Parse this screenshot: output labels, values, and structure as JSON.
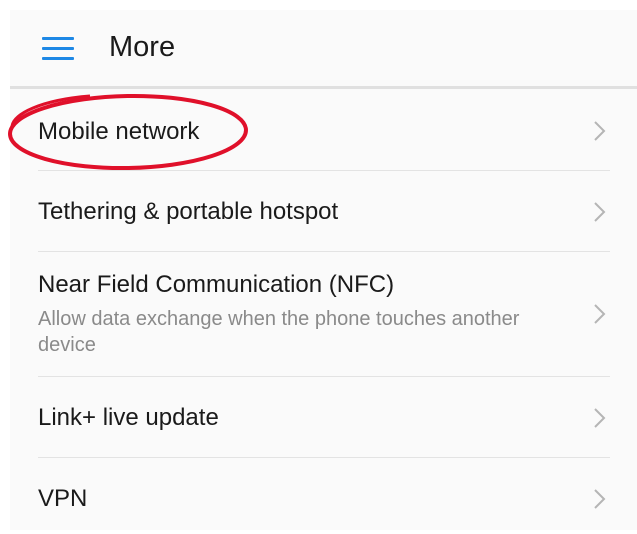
{
  "header": {
    "title": "More",
    "menu_icon": "hamburger-menu-icon",
    "accent_color": "#1e88e5"
  },
  "settings": {
    "items": [
      {
        "title": "Mobile network",
        "subtitle": "",
        "icon": "chevron-right-icon"
      },
      {
        "title": "Tethering & portable hotspot",
        "subtitle": "",
        "icon": "chevron-right-icon"
      },
      {
        "title": "Near Field Communication (NFC)",
        "subtitle": "Allow data exchange when the phone touches another device",
        "icon": "chevron-right-icon"
      },
      {
        "title": "Link+ live update",
        "subtitle": "",
        "icon": "chevron-right-icon"
      },
      {
        "title": "VPN",
        "subtitle": "",
        "icon": "chevron-right-icon"
      }
    ]
  },
  "annotation": {
    "color": "#e0102a",
    "target": "Mobile network"
  }
}
